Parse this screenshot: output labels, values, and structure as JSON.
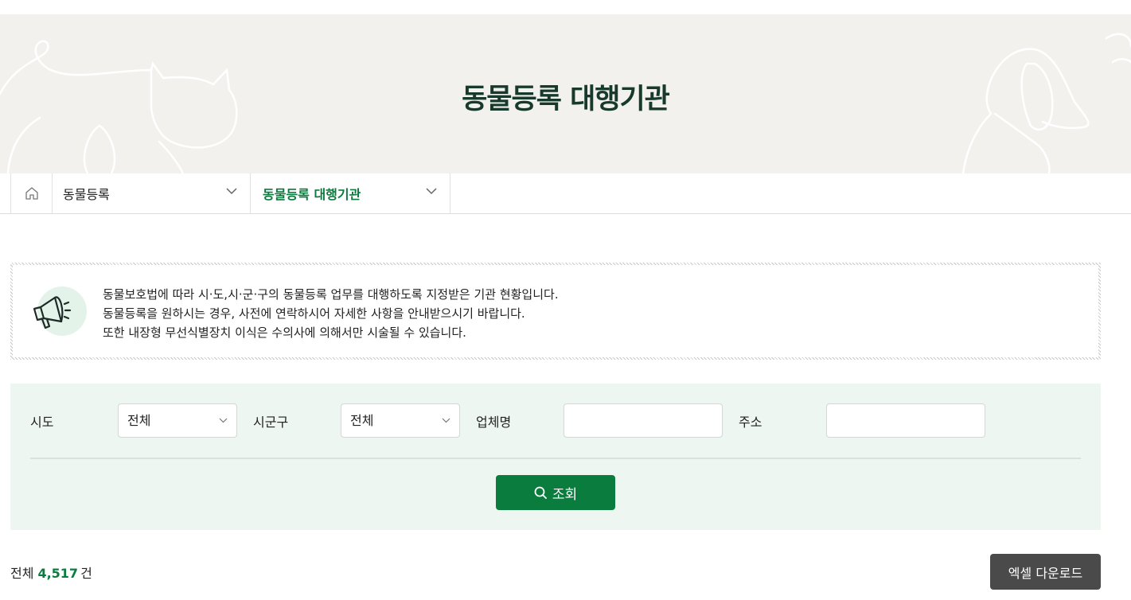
{
  "page_title": "동물등록 대행기관",
  "breadcrumb": {
    "home_icon": "home-icon",
    "level1": "동물등록",
    "level2": "동물등록 대행기관"
  },
  "notice": {
    "icon": "megaphone-icon",
    "lines": [
      "동물보호법에 따라 시·도,시·군·구의 동물등록 업무를 대행하도록 지정받은 기관 현황입니다.",
      "동물등록을 원하시는 경우, 사전에 연락하시어 자세한 사항을 안내받으시기 바랍니다.",
      "또한 내장형 무선식별장치 이식은 수의사에 의해서만 시술될 수 있습니다."
    ]
  },
  "search": {
    "sido_label": "시도",
    "sido_value": "전체",
    "sigungu_label": "시군구",
    "sigungu_value": "전체",
    "company_label": "업체명",
    "company_value": "",
    "address_label": "주소",
    "address_value": "",
    "button_label": "조회",
    "button_icon": "search-icon"
  },
  "results": {
    "total_label": "전체",
    "total_count": "4,517",
    "total_unit": "건",
    "excel_button": "엑셀 다운로드"
  },
  "colors": {
    "accent": "#0a7d3e",
    "hero_bg": "#f2f1ee",
    "search_bg": "#eef6f1",
    "title": "#173a2c"
  }
}
